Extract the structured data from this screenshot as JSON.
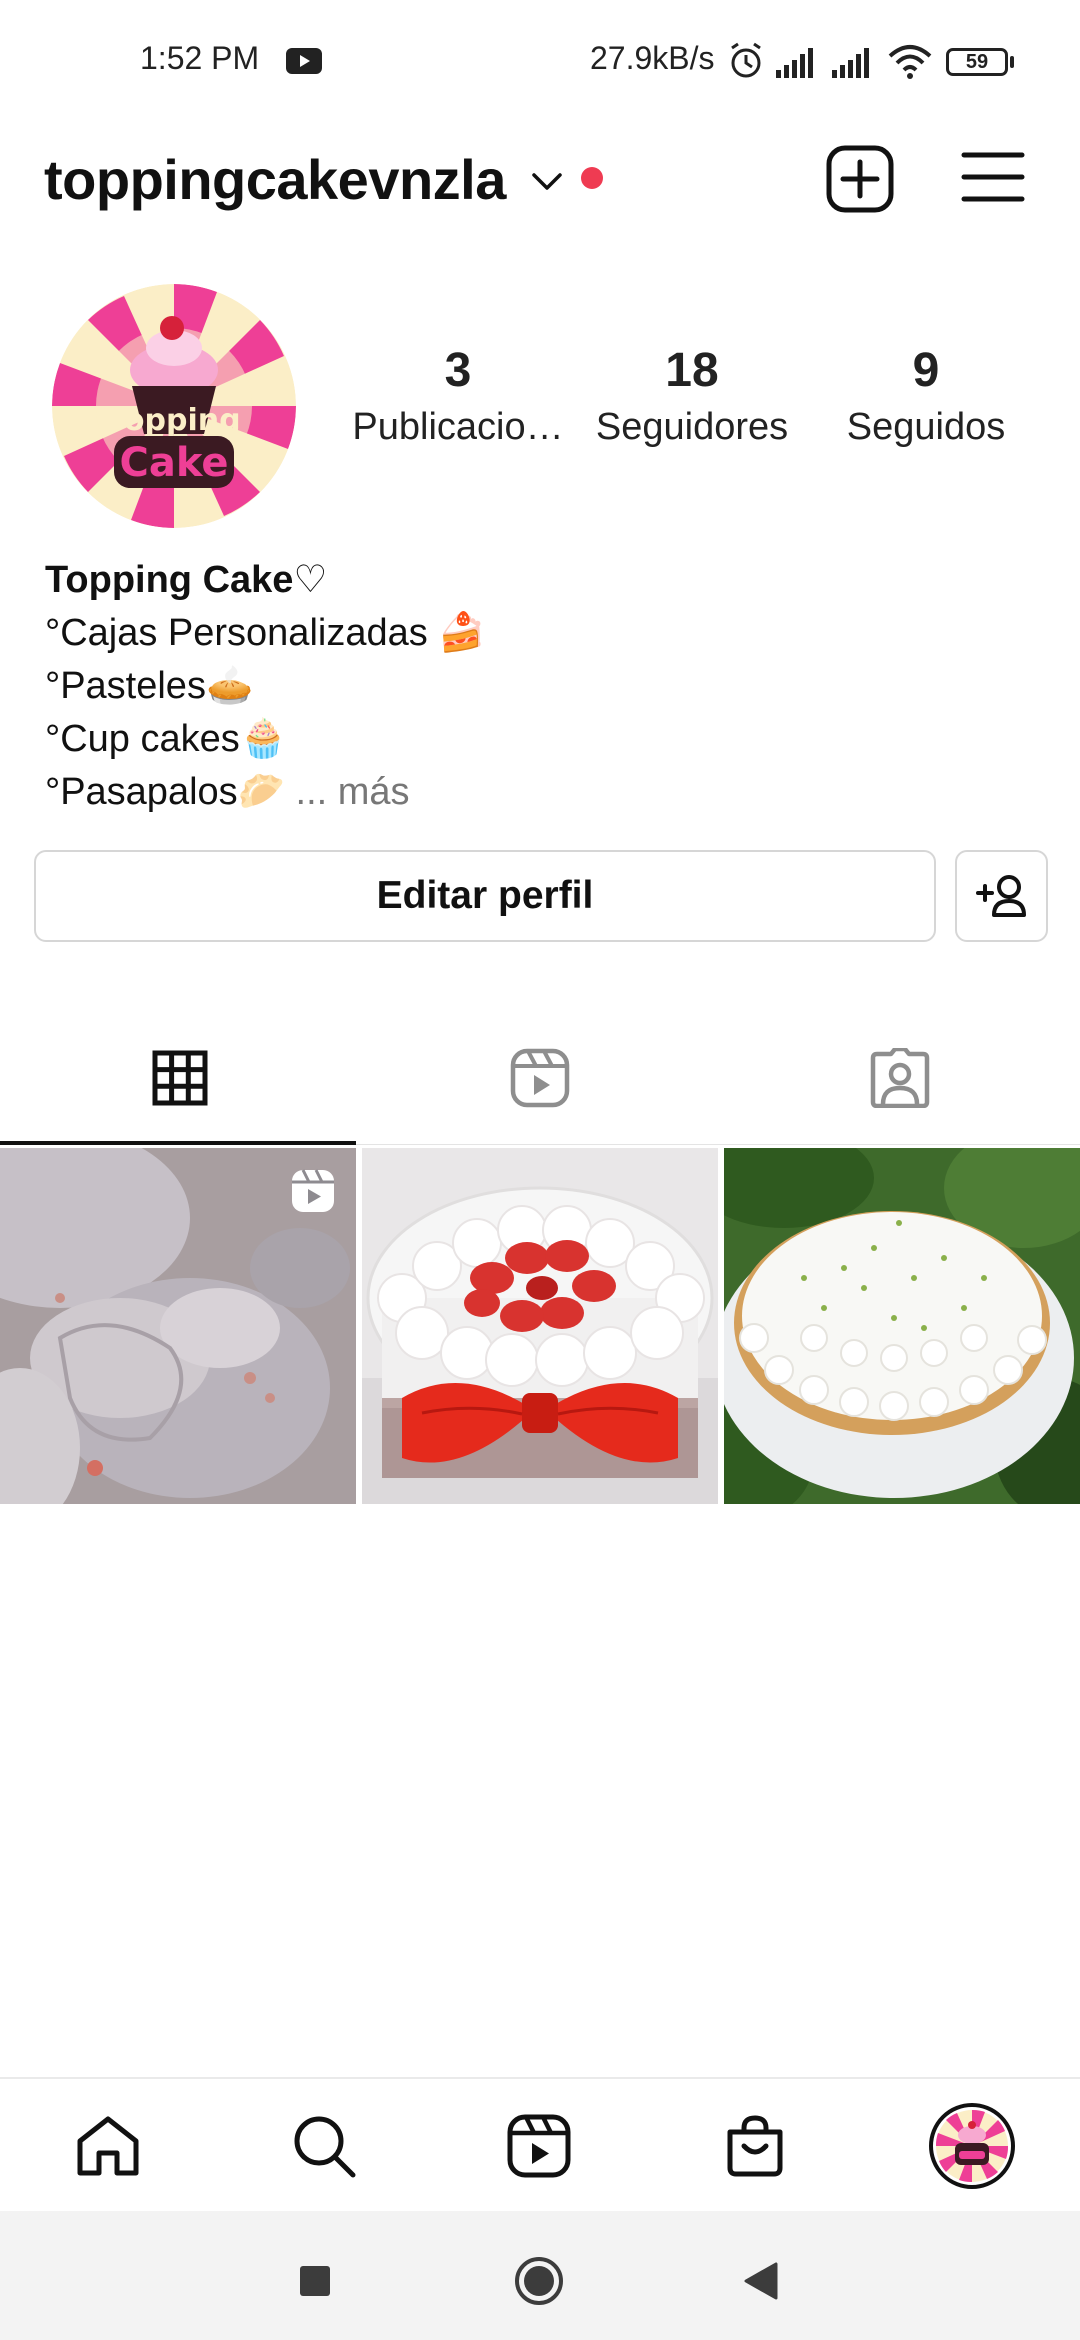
{
  "status_bar": {
    "time": "1:52 PM",
    "network_speed": "27.9kB/s",
    "battery": "59",
    "icons": [
      "youtube-icon",
      "alarm-icon",
      "signal-icon",
      "signal-icon",
      "wifi-icon",
      "battery-icon"
    ]
  },
  "header": {
    "username": "toppingcakevnzla",
    "accent_color": "#ef3b52"
  },
  "profile": {
    "avatar_text_top": "Topping",
    "avatar_text_bottom": "Cake",
    "stats": {
      "posts_count": "3",
      "posts_label": "Publicacio…",
      "followers_count": "18",
      "followers_label": "Seguidores",
      "following_count": "9",
      "following_label": "Seguidos"
    },
    "bio": {
      "name": "Topping Cake♡",
      "lines": [
        "°Cajas Personalizadas 🍰",
        "°Pasteles🥧",
        "°Cup cakes🧁",
        "°Pasapalos🥟"
      ],
      "more": "... más"
    },
    "edit_button": "Editar perfil"
  },
  "tabs": [
    {
      "name": "posts-grid",
      "icon": "grid-icon",
      "active": true
    },
    {
      "name": "reels",
      "icon": "reels-icon",
      "active": false
    },
    {
      "name": "tagged",
      "icon": "tagged-icon",
      "active": false
    }
  ],
  "posts": [
    {
      "id": "post-1",
      "type": "reel",
      "description": "meringue-heart-cakes"
    },
    {
      "id": "post-2",
      "type": "photo",
      "description": "strawberry-cream-cake-red-bow"
    },
    {
      "id": "post-3",
      "type": "photo",
      "description": "lime-cream-pie"
    }
  ],
  "bottom_nav": [
    "home-icon",
    "search-icon",
    "reels-icon",
    "shop-icon",
    "profile-avatar"
  ],
  "system_nav": [
    "recents-icon",
    "home-circle-icon",
    "back-icon"
  ]
}
